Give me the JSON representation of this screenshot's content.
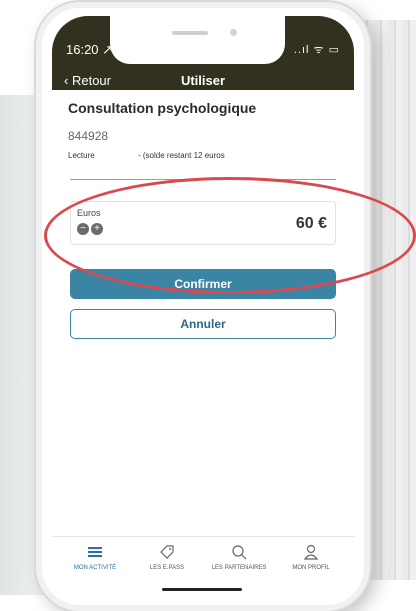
{
  "status": {
    "time": "16:20 ↗",
    "icons": "..ıl ᯤ ▭"
  },
  "header": {
    "back_label": "Retour",
    "title": "Utiliser"
  },
  "content": {
    "heading": "Consultation psychologique",
    "code": "844928",
    "lecture": "Lecture",
    "solde": "- (solde restant 12 euros",
    "euro_label": "Euros",
    "amount": "60 €",
    "minus": "−",
    "plus": "+"
  },
  "buttons": {
    "confirm": "Confirmer",
    "cancel": "Annuler"
  },
  "tabs": [
    {
      "label": "MON ACTIVITÉ",
      "icon": "menu-icon"
    },
    {
      "label": "LES E.PASS",
      "icon": "tag-icon"
    },
    {
      "label": "LES PARTENAIRES",
      "icon": "search-icon"
    },
    {
      "label": "MON PROFIL",
      "icon": "user-icon"
    }
  ],
  "colors": {
    "header": "#32301f",
    "accent": "#3a84a4",
    "annotation": "#d9494e"
  }
}
